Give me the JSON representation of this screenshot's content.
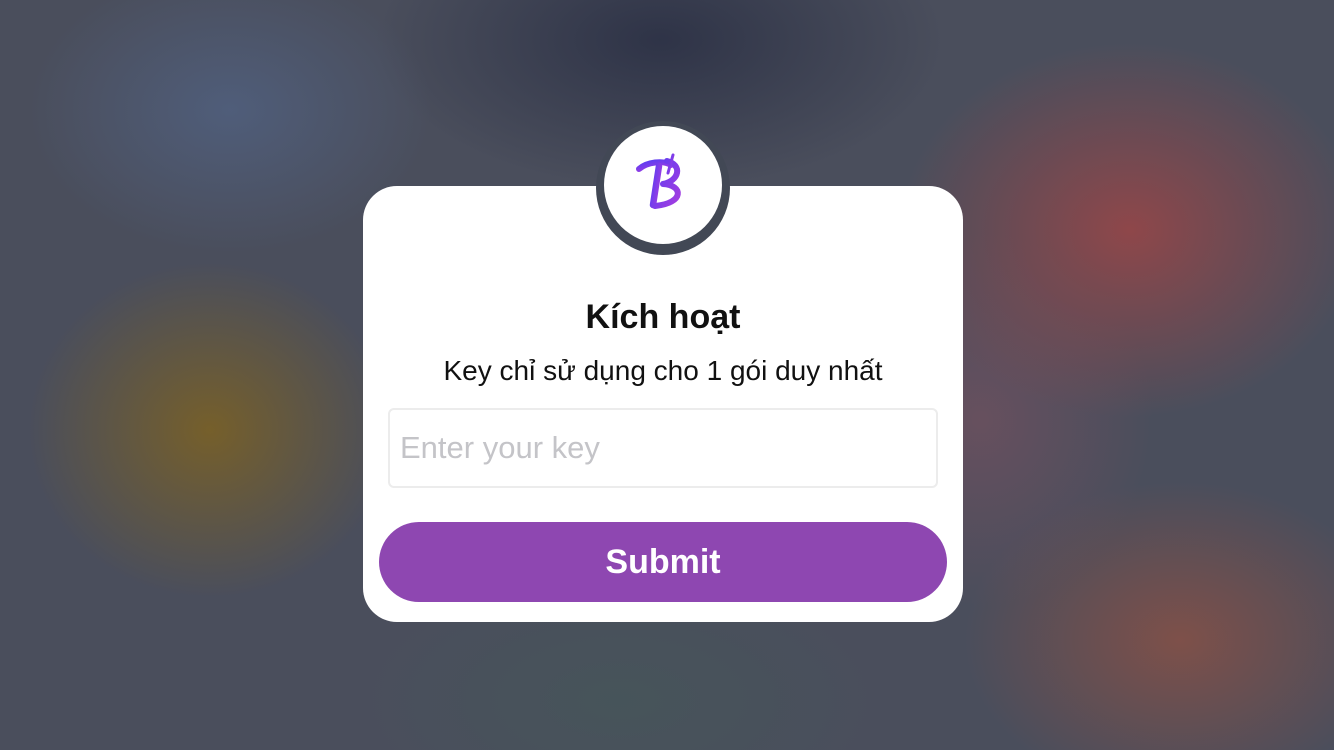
{
  "background": {
    "style": "blurred"
  },
  "activation_dialog": {
    "logo": {
      "icon": "brand-b-logo-icon",
      "gradient_start": "#5b3df2",
      "gradient_end": "#a43de0"
    },
    "title": "Kích hoạt",
    "subtitle": "Key chỉ sử dụng cho 1 gói duy nhất",
    "key_input": {
      "value": "",
      "placeholder": "Enter your key"
    },
    "submit_label": "Submit",
    "accent_color": "#8e47b1"
  }
}
